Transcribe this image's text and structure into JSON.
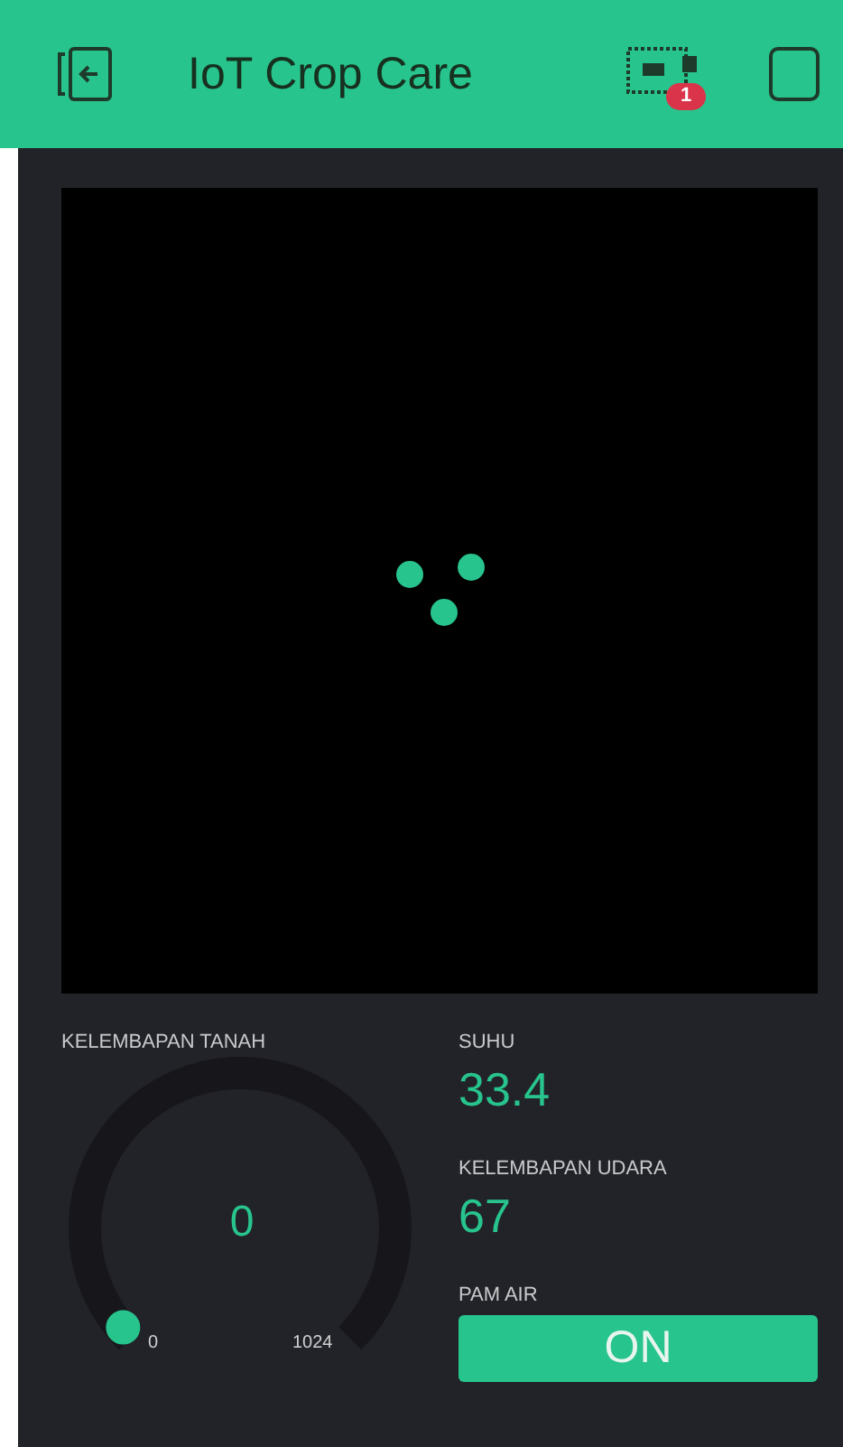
{
  "header": {
    "title": "IoT Crop Care",
    "device_badge": "1"
  },
  "gauge": {
    "label": "KELEMBAPAN TANAH",
    "value": "0",
    "min": "0",
    "max": "1024"
  },
  "displays": [
    {
      "label": "SUHU",
      "value": "33.4"
    },
    {
      "label": "KELEMBAPAN UDARA",
      "value": "67"
    }
  ],
  "button": {
    "label": "PAM AIR",
    "text": "ON",
    "on": true
  }
}
